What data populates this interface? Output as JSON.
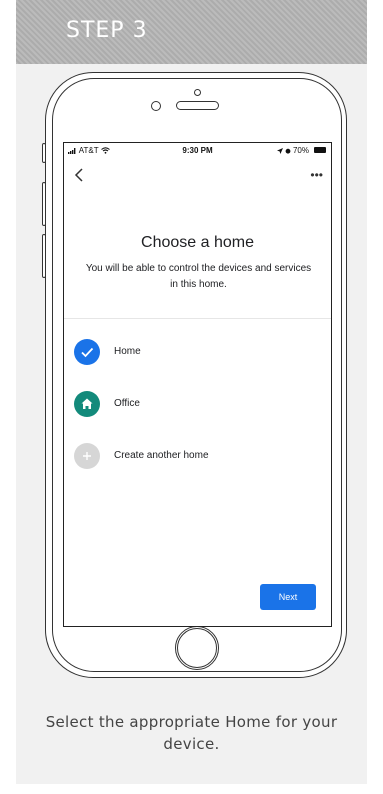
{
  "header": {
    "step_label": "STEP 3"
  },
  "status_bar": {
    "carrier": "AT&T",
    "time": "9:30 PM",
    "battery": "70%"
  },
  "nav": {
    "back_icon": "chevron-left-icon",
    "more_icon": "more-horizontal-icon",
    "more_glyph": "•••"
  },
  "screen": {
    "title": "Choose a home",
    "subtitle": "You will be able to control the devices and services in this home.",
    "options": [
      {
        "label": "Home",
        "icon": "check-icon",
        "color": "#1a73e8",
        "selected": true
      },
      {
        "label": "Office",
        "icon": "house-icon",
        "color": "#138a7b",
        "selected": false
      },
      {
        "label": "Create another home",
        "icon": "plus-icon",
        "color": "#d6d6d6",
        "selected": false
      }
    ],
    "next_label": "Next"
  },
  "caption": "Select the appropriate Home for your device.",
  "colors": {
    "accent": "#1a73e8",
    "office_icon": "#138a7b",
    "header_bg": "#b3b3b3"
  }
}
